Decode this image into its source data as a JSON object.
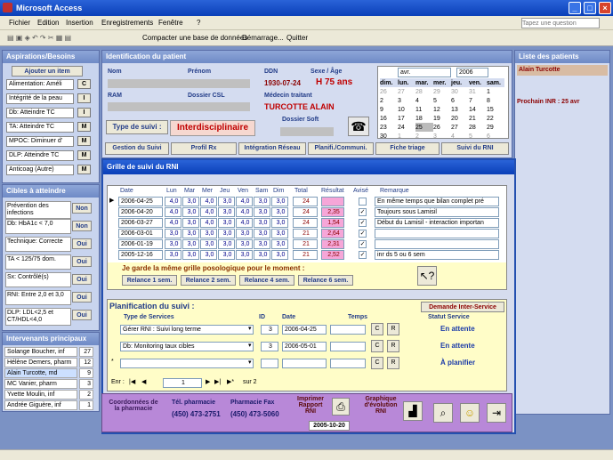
{
  "app": {
    "title": "Microsoft Access"
  },
  "menu": {
    "items": [
      "Fichier",
      "Edition",
      "Insertion",
      "Enregistrements",
      "Fenêtre",
      "?"
    ],
    "help_placeholder": "Tapez une question"
  },
  "toolbar": {
    "compact": "Compacter une base de données",
    "start": "Démarrage...",
    "quit": "Quitter"
  },
  "aspirations": {
    "title": "Aspirations/Besoins",
    "add_label": "Ajouter un item",
    "items": [
      {
        "label": "Alimentation: Améli",
        "code": "C"
      },
      {
        "label": "Intégrité de la peau",
        "code": "I"
      },
      {
        "label": "Db: Atteindre TC",
        "code": "I"
      },
      {
        "label": "TA: Atteindre TC",
        "code": "M"
      },
      {
        "label": "MPOC: Diminuer d'",
        "code": "M"
      },
      {
        "label": "DLP: Atteindre TC",
        "code": "M"
      },
      {
        "label": "Anticoag (Autre)",
        "code": "M"
      }
    ]
  },
  "cibles": {
    "title": "Cibles à atteindre",
    "items": [
      {
        "label": "Prévention des infections",
        "value": "Non"
      },
      {
        "label": "Db: HbA1c < 7,0",
        "value": "Non"
      },
      {
        "label": "Technique: Correcte",
        "value": "Oui"
      },
      {
        "label": "TA < 125/75 dom.",
        "value": "Oui"
      },
      {
        "label": "Sx: Contrôlé(s)",
        "value": "Oui"
      },
      {
        "label": "RNI: Entre 2,0 et 3,0",
        "value": "Oui"
      },
      {
        "label": "DLP: LDL<2,5 et CT/HDL<4,0",
        "value": "Oui"
      }
    ]
  },
  "intervenants": {
    "title": "Intervenants principaux",
    "items": [
      {
        "name": "Solange Boucher, inf",
        "count": "27"
      },
      {
        "name": "Hélène Demers, pharm",
        "count": "12"
      },
      {
        "name": "Alain Turcotte, md",
        "count": "9"
      },
      {
        "name": "MC Vanier, pharm",
        "count": "3"
      },
      {
        "name": "Yvette Moulin, inf",
        "count": "2"
      },
      {
        "name": "Andrée Giguère, inf",
        "count": "1"
      }
    ]
  },
  "patient": {
    "section_title": "Identification du patient",
    "nom_label": "Nom",
    "prenom_label": "Prénom",
    "ram_label": "RAM",
    "dossier_csl_label": "Dossier CSL",
    "ddn_label": "DDN",
    "ddn": "1930-07-24",
    "sexe_label": "Sexe / Âge",
    "sexe_age": "H  75 ans",
    "medecin_label": "Médecin traitant",
    "medecin": "TURCOTTE ALAIN",
    "dossier_soft_label": "Dossier Soft",
    "type_suivi_label": "Type de suivi :",
    "type_suivi": "Interdisciplinaire"
  },
  "calendar": {
    "month": "avr.",
    "year": "2006",
    "days": [
      "dim.",
      "lun.",
      "mar.",
      "mer.",
      "jeu.",
      "ven.",
      "sam."
    ],
    "rows": [
      [
        "26",
        "27",
        "28",
        "29",
        "30",
        "31",
        "1"
      ],
      [
        "2",
        "3",
        "4",
        "5",
        "6",
        "7",
        "8"
      ],
      [
        "9",
        "10",
        "11",
        "12",
        "13",
        "14",
        "15"
      ],
      [
        "16",
        "17",
        "18",
        "19",
        "20",
        "21",
        "22"
      ],
      [
        "23",
        "24",
        "25",
        "26",
        "27",
        "28",
        "29"
      ],
      [
        "30",
        "1",
        "2",
        "3",
        "4",
        "5",
        "6"
      ]
    ]
  },
  "nav": {
    "items": [
      "Gestion du Suivi",
      "Profil Rx",
      "Intégration Réseau",
      "Planifi./Communi.",
      "Fiche triage",
      "Suivi du RNI"
    ]
  },
  "patients_list": {
    "title": "Liste des patients",
    "current": "Alain Turcotte",
    "prochain": "Prochain INR : 25 avr"
  },
  "rni": {
    "title": "Grille de suivi du RNI",
    "headers": [
      "Date",
      "Lun",
      "Mar",
      "Mer",
      "Jeu",
      "Ven",
      "Sam",
      "Dim",
      "Total",
      "Résultat",
      "Avisé",
      "Remarque"
    ],
    "rows": [
      {
        "date": "2006-04-25",
        "v": [
          "4,0",
          "3,0",
          "4,0",
          "3,0",
          "4,0",
          "3,0",
          "3,0"
        ],
        "total": "24",
        "result": "",
        "avise": false,
        "remarque": "En même temps que bilan complet pré"
      },
      {
        "date": "2006-04-20",
        "v": [
          "4,0",
          "3,0",
          "4,0",
          "3,0",
          "4,0",
          "3,0",
          "3,0"
        ],
        "total": "24",
        "result": "2,35",
        "avise": true,
        "remarque": "Toujours sous Lamisil"
      },
      {
        "date": "2006-03-27",
        "v": [
          "4,0",
          "3,0",
          "4,0",
          "3,0",
          "4,0",
          "3,0",
          "3,0"
        ],
        "total": "24",
        "result": "1,54",
        "avise": true,
        "remarque": "Début du Lamisil - interaction importan"
      },
      {
        "date": "2006-03-01",
        "v": [
          "3,0",
          "3,0",
          "3,0",
          "3,0",
          "3,0",
          "3,0",
          "3,0"
        ],
        "total": "21",
        "result": "2,64",
        "avise": true,
        "remarque": ""
      },
      {
        "date": "2006-01-19",
        "v": [
          "3,0",
          "3,0",
          "3,0",
          "3,0",
          "3,0",
          "3,0",
          "3,0"
        ],
        "total": "21",
        "result": "2,31",
        "avise": true,
        "remarque": ""
      },
      {
        "date": "2005-12-16",
        "v": [
          "3,0",
          "3,0",
          "3,0",
          "3,0",
          "3,0",
          "3,0",
          "3,0"
        ],
        "total": "21",
        "result": "2,52",
        "avise": true,
        "remarque": "inr ds 5 ou 6 sem"
      }
    ],
    "notice": "Je garde la même grille posologique pour le moment :",
    "relances": [
      "Relance 1 sem.",
      "Relance 2 sem.",
      "Relance 4 sem.",
      "Relance 6 sem."
    ]
  },
  "planif": {
    "title": "Planification du suivi :",
    "request_btn": "Demande Inter-Service",
    "headers": [
      "Type de Services",
      "ID",
      "Date",
      "Temps",
      "Statut Service"
    ],
    "rows": [
      {
        "type": "Gérer RNI : Suivi long terme",
        "id": "3",
        "date": "2006-04-25",
        "status": "En attente"
      },
      {
        "type": "Db: Monitoring taux cibles",
        "id": "3",
        "date": "2006-05-01",
        "status": "En attente"
      },
      {
        "type": "",
        "id": "",
        "date": "",
        "status": "À planifier"
      }
    ],
    "c_label": "C",
    "r_label": "R",
    "nav_label": "Enr :",
    "nav_current": "1",
    "nav_total": "sur 2"
  },
  "footer": {
    "coord": "Coordonnées de la pharmacie",
    "tel_label": "Tél. pharmacie",
    "tel": "(450) 473-2751",
    "fax_label": "Pharmacie Fax",
    "fax": "(450) 473-5060",
    "print_label": "Imprimer Rapport RNI",
    "print_date": "2005-10-20",
    "graph_label": "Graphique d'évolution RNI"
  }
}
